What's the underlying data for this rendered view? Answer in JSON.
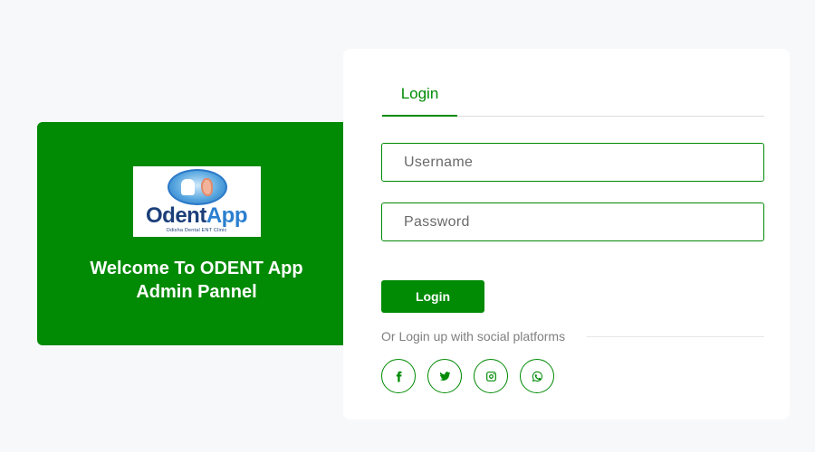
{
  "welcome": {
    "title_line1": "Welcome To ODENT App",
    "title_line2": "Admin Pannel",
    "logo": {
      "word_part1": "Odent",
      "word_part2": "App",
      "tagline": "Odisha Dental ENT Clinic"
    }
  },
  "login_card": {
    "tab_label": "Login",
    "username_placeholder": "Username",
    "password_placeholder": "Password",
    "login_button_label": "Login",
    "social_text": "Or Login up with social platforms",
    "social_buttons": [
      {
        "icon": "facebook-icon"
      },
      {
        "icon": "twitter-icon"
      },
      {
        "icon": "instagram-icon"
      },
      {
        "icon": "whatsapp-icon"
      }
    ]
  },
  "colors": {
    "brand_green": "#018a04",
    "background": "#f7f8fa",
    "card": "#ffffff"
  }
}
